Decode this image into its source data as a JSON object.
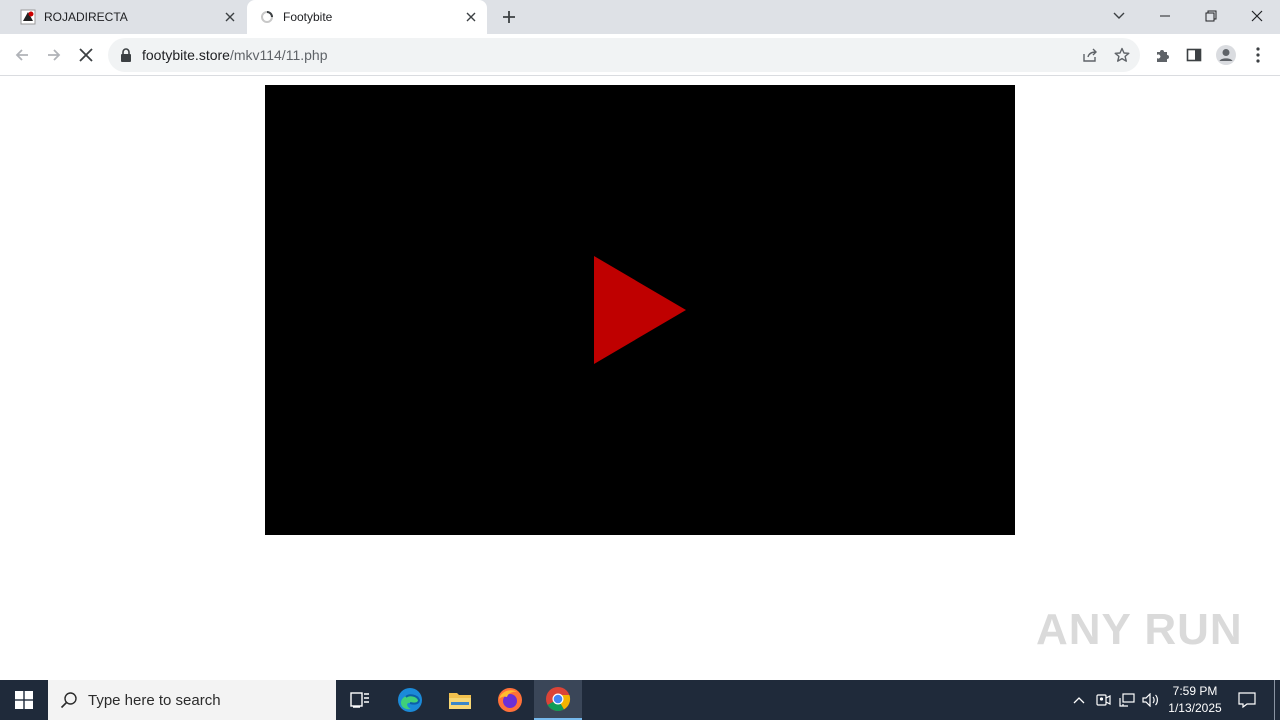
{
  "browser": {
    "tabs": [
      {
        "title": "ROJADIRECTA",
        "active": false
      },
      {
        "title": "Footybite",
        "active": true
      }
    ],
    "url": {
      "host": "footybite.store",
      "path": "/mkv114/11.php"
    }
  },
  "page": {
    "player": {
      "background": "#000000",
      "play_color": "#bf0000"
    },
    "watermark": "ANY RUN"
  },
  "taskbar": {
    "search_placeholder": "Type here to search",
    "time": "7:59 PM",
    "date": "1/13/2025"
  },
  "colors": {
    "tabstrip": "#dee1e6",
    "taskbar": "#1f2a3a",
    "accent": "#76b9ed"
  }
}
